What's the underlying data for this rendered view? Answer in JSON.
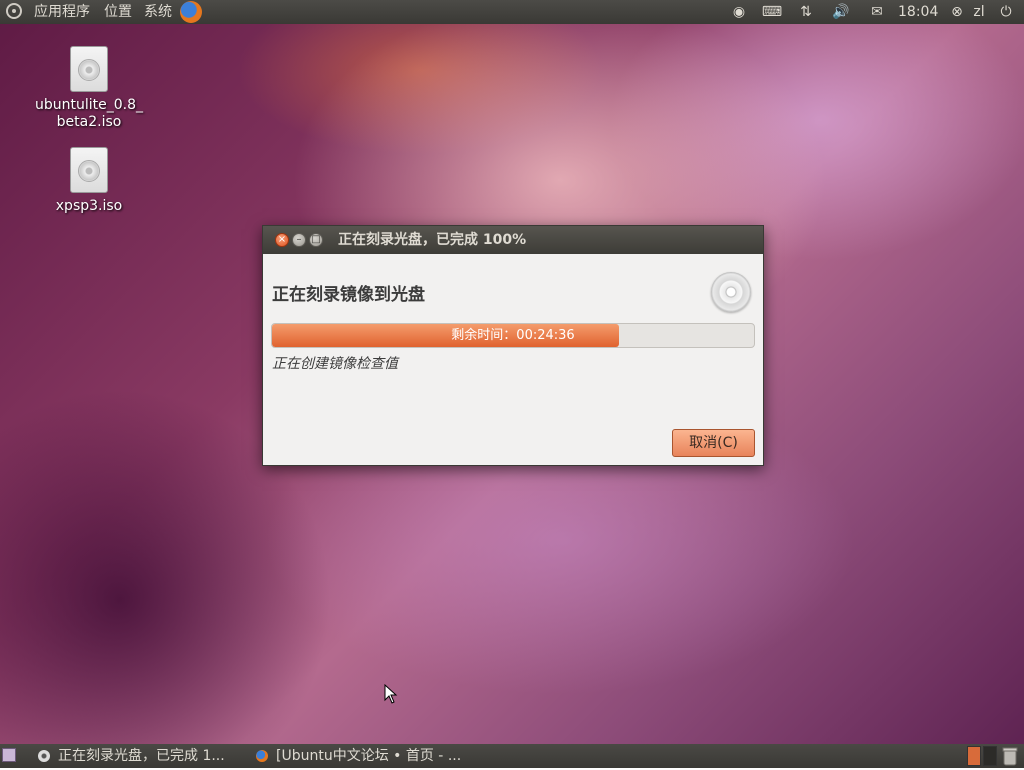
{
  "top_panel": {
    "menus": [
      "应用程序",
      "位置",
      "系统"
    ],
    "clock": "18:04",
    "user": "zl",
    "tray_icons": [
      "disc-activity-icon",
      "keyboard-icon",
      "network-icon",
      "volume-icon",
      "mail-icon",
      "session-close-icon",
      "power-icon"
    ]
  },
  "desktop": {
    "icons": [
      {
        "label_line1": "ubuntulite_0.8_",
        "label_line2": "beta2.iso"
      },
      {
        "label_line1": "xpsp3.iso",
        "label_line2": ""
      }
    ]
  },
  "dialog": {
    "title": "正在刻录光盘，已完成 100%",
    "heading": "正在刻录镜像到光盘",
    "progress_fraction": 0.72,
    "progress_text": "剩余时间：00:24:36",
    "status": "正在创建镜像检查值",
    "cancel_label": "取消(C)"
  },
  "bottom_panel": {
    "tasks": [
      {
        "label": "正在刻录光盘，已完成 1..."
      },
      {
        "label": "[Ubuntu中文论坛 • 首页 - ..."
      }
    ]
  },
  "colors": {
    "accent": "#e0622f",
    "panel": "#3c3b37"
  }
}
